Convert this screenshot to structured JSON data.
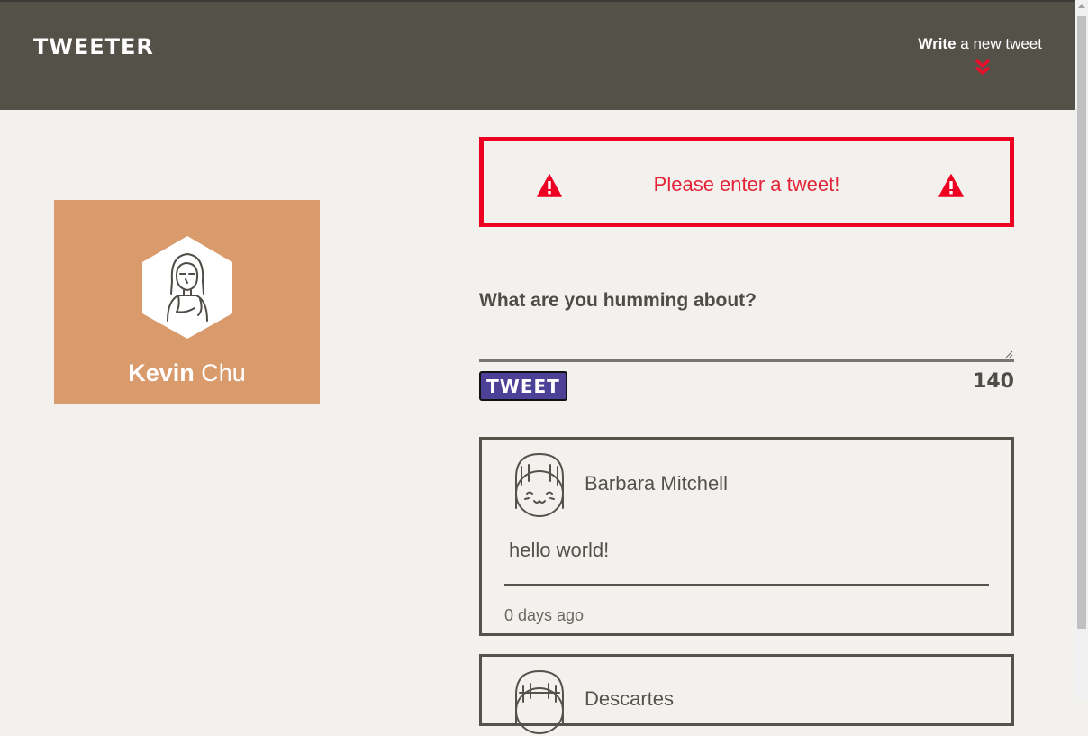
{
  "header": {
    "logo": "TWEETER",
    "compose_bold": "Write",
    "compose_rest": " a new tweet",
    "compose_icon": "double-chevron-down-icon",
    "accent_color": "#e8112d",
    "background_color": "#545149"
  },
  "profile": {
    "first_name": "Kevin",
    "last_name": "Chu",
    "avatar_icon": "girl-avatar-hexagon-icon",
    "background_color": "#d99a6c"
  },
  "composer": {
    "error_message": "Please enter a tweet!",
    "error_icon": "warning-triangle-icon",
    "error_color": "#ee0022",
    "prompt": "What are you humming about?",
    "input_value": "",
    "button_label": "TWEET",
    "button_color": "#4c4097",
    "char_count": "140"
  },
  "tweets": [
    {
      "author": "Barbara Mitchell",
      "avatar_icon": "smiling-girl-avatar-icon",
      "content": "hello world!",
      "timestamp": "0 days ago"
    },
    {
      "author": "Descartes",
      "avatar_icon": "girl-avatar-icon",
      "content": "",
      "timestamp": ""
    }
  ]
}
